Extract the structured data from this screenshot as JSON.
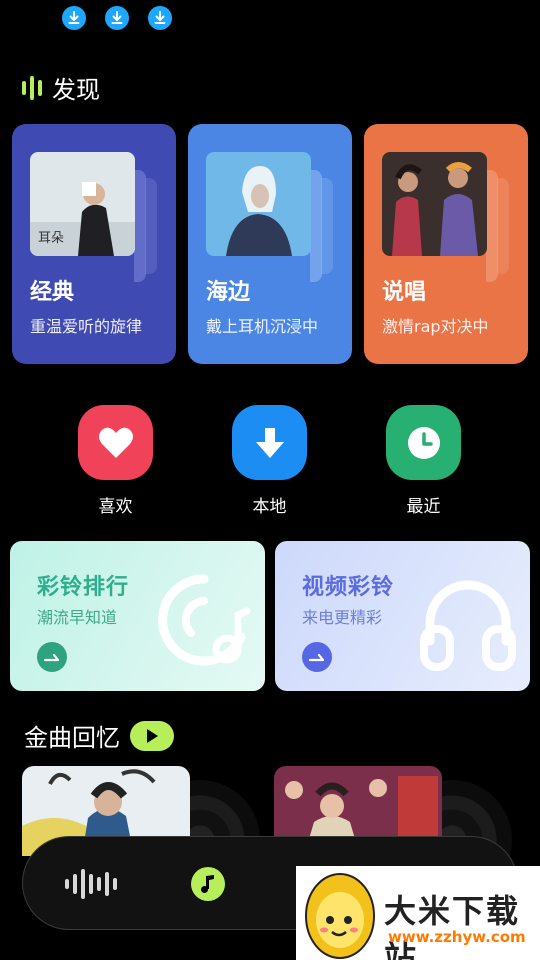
{
  "status": {
    "icons": [
      "download-icon",
      "download-icon",
      "download-icon"
    ],
    "color": "#1ea7ff"
  },
  "discover": {
    "title": "发现",
    "cards": [
      {
        "title": "经典",
        "subtitle": "重温爱听的旋律",
        "color": "#3f4bb2"
      },
      {
        "title": "海边",
        "subtitle": "戴上耳机沉浸中",
        "color": "#4b86e5"
      },
      {
        "title": "说唱",
        "subtitle": "激情rap对决中",
        "color": "#ea7446"
      }
    ]
  },
  "shortcuts": [
    {
      "label": "喜欢",
      "icon": "heart-icon",
      "color": "#f0435a"
    },
    {
      "label": "本地",
      "icon": "download-arrow-icon",
      "color": "#1c8df2"
    },
    {
      "label": "最近",
      "icon": "clock-icon",
      "color": "#27b072"
    }
  ],
  "promos": [
    {
      "title": "彩铃排行",
      "subtitle": "潮流早知道",
      "title_color": "#2fae8d",
      "sub_color": "#3fa88a",
      "accent": "#2fa27f"
    },
    {
      "title": "视频彩铃",
      "subtitle": "来电更精彩",
      "title_color": "#5b6be0",
      "sub_color": "#6d7ed9",
      "accent": "#5667e6"
    }
  ],
  "golden": {
    "title": "金曲回忆",
    "albums": [
      "album-cover-1",
      "album-cover-2"
    ]
  },
  "player": {
    "accent": "#b6ef5a"
  },
  "watermark": {
    "name": "大米下载站",
    "url": "www.zzhyw.com"
  }
}
